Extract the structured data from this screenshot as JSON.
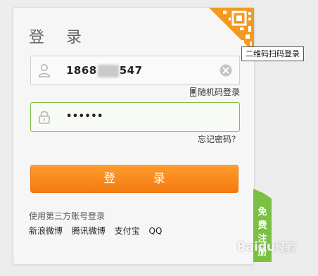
{
  "login": {
    "title": "登 录",
    "qr_tooltip": "二维码扫码登录",
    "username_prefix": "1868",
    "username_suffix": "547",
    "password_dots": "••••••",
    "random_code_link": "随机码登录",
    "forgot_password_link": "忘记密码？",
    "login_button": "登 录"
  },
  "third_party": {
    "title": "使用第三方账号登录",
    "providers": [
      "新浪微博",
      "腾讯微博",
      "支付宝",
      "QQ"
    ]
  },
  "side_tab": {
    "label": "免费注册"
  },
  "watermark": {
    "text": "Baidu",
    "sub": "经验"
  },
  "colors": {
    "accent_orange": "#f47b0e",
    "qr_orange": "#f39a1e",
    "focus_green": "#7ac143",
    "tab_green": "#7ac143"
  },
  "icons": [
    "qr-code-icon",
    "user-icon",
    "clear-icon",
    "phone-icon",
    "lock-icon"
  ]
}
